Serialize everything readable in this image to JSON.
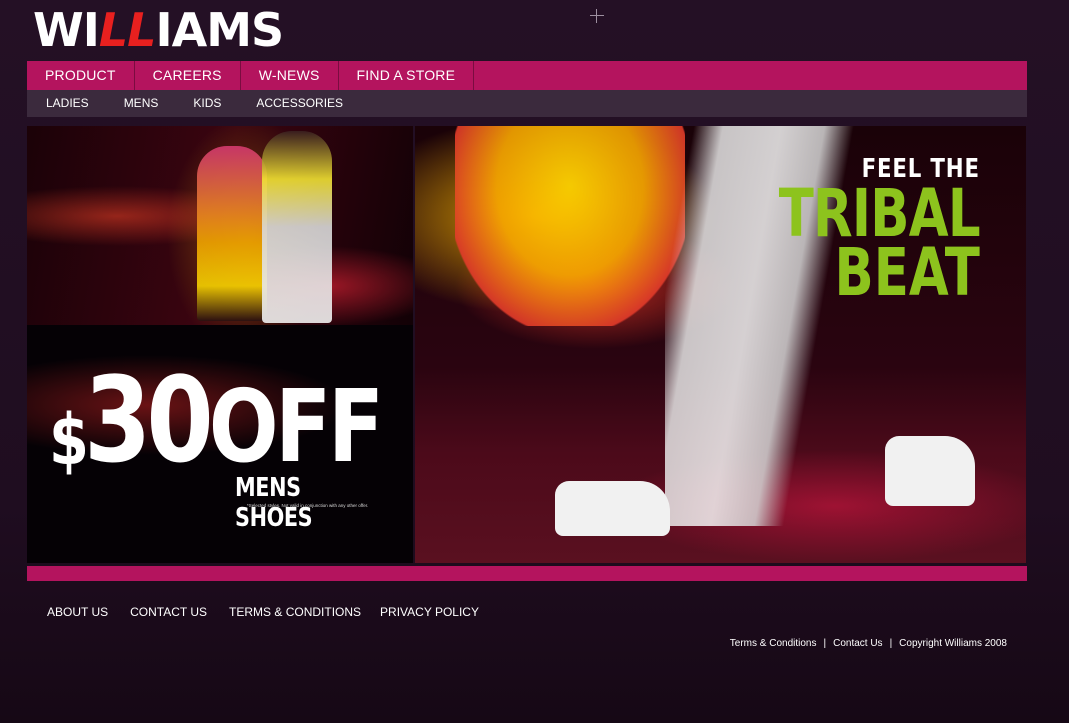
{
  "brand": {
    "logo_text_1": "WI",
    "logo_text_red": "LL",
    "logo_text_2": "IAMS"
  },
  "nav_primary": [
    {
      "label": "PRODUCT"
    },
    {
      "label": "CAREERS"
    },
    {
      "label": "W-NEWS"
    },
    {
      "label": "FIND A STORE"
    }
  ],
  "nav_secondary": [
    {
      "label": "LADIES"
    },
    {
      "label": "MENS"
    },
    {
      "label": "KIDS"
    },
    {
      "label": "ACCESSORIES"
    }
  ],
  "promo": {
    "dollar": "$",
    "amount": "30",
    "off": "OFF",
    "sub": "MENS SHOES",
    "note": "*Selected styles. Not valid in conjunction with any other offer."
  },
  "hero": {
    "line1": "FEEL THE",
    "line2": "TRIBAL",
    "line3": "BEAT"
  },
  "footer_links": [
    {
      "label": "ABOUT US"
    },
    {
      "label": "CONTACT US"
    },
    {
      "label": "TERMS & CONDITIONS"
    },
    {
      "label": "PRIVACY POLICY"
    }
  ],
  "legal": {
    "terms": "Terms & Conditions",
    "contact": "Contact Us",
    "copyright": "Copyright Williams 2008",
    "separator": "|"
  },
  "colors": {
    "accent": "#b4145e",
    "subnav": "#3b2a3d",
    "headline_green": "#8dc31d",
    "logo_red": "#e8201f"
  }
}
